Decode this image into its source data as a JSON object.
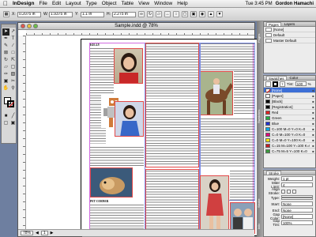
{
  "menubar": {
    "app_name": "InDesign",
    "menus": [
      "File",
      "Edit",
      "Layout",
      "Type",
      "Object",
      "Table",
      "View",
      "Window",
      "Help"
    ],
    "clock": "Tue 3:45 PM",
    "user": "Gordon Hamachi"
  },
  "control_bar": {
    "x_label": "X:",
    "x_value": "0.2075 in",
    "y_label": "Y:",
    "y_value": "1.1 in",
    "w_label": "W:",
    "w_value": "1.9375 in",
    "h_label": "H:",
    "h_value": "2.275 in"
  },
  "document": {
    "title": "Sample.indd @ 78%",
    "zoom": "78%",
    "page_number": "1"
  },
  "layout_text": {
    "top_headline": "KELLY",
    "pet_caption": "PET CORNER",
    "seal_text": "Page 1"
  },
  "pages_panel": {
    "tabs": [
      "Pages",
      "Layers"
    ],
    "items": [
      "[None]",
      "Default",
      "Master Default"
    ]
  },
  "side_tabs": [
    "Pages",
    "Swatches",
    "Stroke",
    "Info"
  ],
  "swatches_panel": {
    "tabs": [
      "Swatches",
      "Color"
    ],
    "tint_label": "Tint:",
    "tint_value": "100",
    "percent": "%",
    "items": [
      {
        "name": "[None]",
        "color": "none",
        "selected": true
      },
      {
        "name": "[Paper]",
        "color": "#ffffff"
      },
      {
        "name": "[Black]",
        "color": "#000000"
      },
      {
        "name": "[Registration]",
        "color": "#000000"
      },
      {
        "name": "Red",
        "color": "#e02020"
      },
      {
        "name": "Green",
        "color": "#20b040"
      },
      {
        "name": "Blue",
        "color": "#2030d0"
      },
      {
        "name": "C=100 M=0 Y=0 K=0",
        "color": "#00a8e8"
      },
      {
        "name": "C=0 M=100 Y=0 K=0",
        "color": "#e0007a"
      },
      {
        "name": "C=0 M=0 Y=100 K=0",
        "color": "#ffe600"
      },
      {
        "name": "C=15 M=100 Y=100 K=0",
        "color": "#c41e24"
      },
      {
        "name": "C=75 M=5 Y=100 K=0",
        "color": "#3a9a3c"
      }
    ]
  },
  "stroke_panel": {
    "title": "Stroke",
    "weight_label": "Weight:",
    "weight_value": "1 pt",
    "miter_label": "Miter Limit:",
    "miter_value": "4",
    "align_label": "Align Stroke:",
    "type_label": "Type:",
    "start_label": "Start:",
    "start_value": "None",
    "end_label": "End:",
    "end_value": "None",
    "gap_color_label": "Gap Color:",
    "gap_color_value": "[None]",
    "gap_tint_label": "Gap Tint:",
    "gap_tint_value": "100%"
  }
}
